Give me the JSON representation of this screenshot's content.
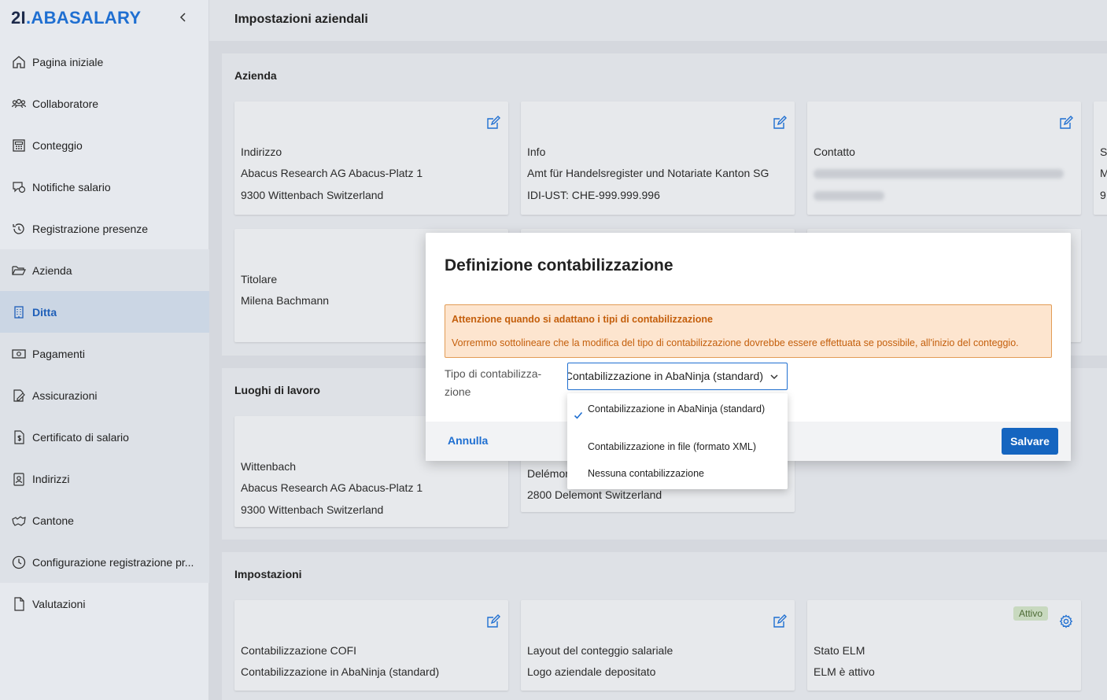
{
  "logo": {
    "prefix": "2I",
    "dot": ".",
    "name": "ABASALARY"
  },
  "sidebar": {
    "items": [
      {
        "label": "Pagina iniziale"
      },
      {
        "label": "Collaboratore"
      },
      {
        "label": "Conteggio"
      },
      {
        "label": "Notifiche salario"
      },
      {
        "label": "Registrazione presenze"
      },
      {
        "label": "Azienda"
      },
      {
        "label": "Ditta"
      },
      {
        "label": "Pagamenti"
      },
      {
        "label": "Assicurazioni"
      },
      {
        "label": "Certificato di salario"
      },
      {
        "label": "Indirizzi"
      },
      {
        "label": "Cantone"
      },
      {
        "label": "Configurazione registrazione pr..."
      },
      {
        "label": "Valutazioni"
      }
    ]
  },
  "page": {
    "title": "Impostazioni aziendali"
  },
  "azienda": {
    "title": "Azienda",
    "indirizzo": {
      "label": "Indirizzo",
      "line1": "Abacus Research AG  Abacus-Platz 1",
      "line2": "9300 Wittenbach  Switzerland"
    },
    "info": {
      "label": "Info",
      "line1": "Amt für Handelsregister und Notariate Kanton SG",
      "line2": "IDI-UST: CHE-999.999.996"
    },
    "contatto": {
      "label": "Contatto"
    },
    "partial": {
      "label": "S",
      "line1": "M",
      "line2": "9"
    },
    "titolare": {
      "label": "Titolare",
      "line1": "Milena Bachmann"
    }
  },
  "luoghi": {
    "title": "Luoghi di lavoro",
    "wittenbach": {
      "label": "Wittenbach",
      "line1": "Abacus Research AG  Abacus-Platz 1",
      "line2": "9300 Wittenbach  Switzerland"
    },
    "delemont": {
      "label": "Delémor",
      "line2": "2800 Delemont  Switzerland"
    }
  },
  "impostazioni": {
    "title": "Impostazioni",
    "cofi": {
      "label": "Contabilizzazione COFI",
      "line1": "Contabilizzazione in AbaNinja (standard)"
    },
    "layout": {
      "label": "Layout del conteggio salariale",
      "line1": "Logo aziendale depositato"
    },
    "elm": {
      "label": "Stato ELM",
      "line1": "ELM è attivo",
      "badge": "Attivo"
    }
  },
  "dialog": {
    "title": "Definizione contabilizzazione",
    "warning_title": "Attenzione quando si adattano i tipi di contabilizzazione",
    "warning_text": "Vorremmo sottolineare che la modifica del tipo di contabilizzazione dovrebbe essere effettuata se possibile, all'inizio del conteggio.",
    "field_label": "Tipo di contabilizza- zione",
    "select_value": "Contabilizzazione in AbaNinja (standard)",
    "cancel": "Annulla",
    "save": "Salvare",
    "options": [
      "Contabilizzazione in AbaNinja (standard)",
      "Contabilizzazione in file (formato XML)",
      "Nessuna contabilizzazione"
    ]
  },
  "colors": {
    "accent": "#1f6fd1",
    "warning_bg": "#fde5cf",
    "warning_text": "#c45f0c",
    "badge_bg": "#c8d9bf"
  }
}
